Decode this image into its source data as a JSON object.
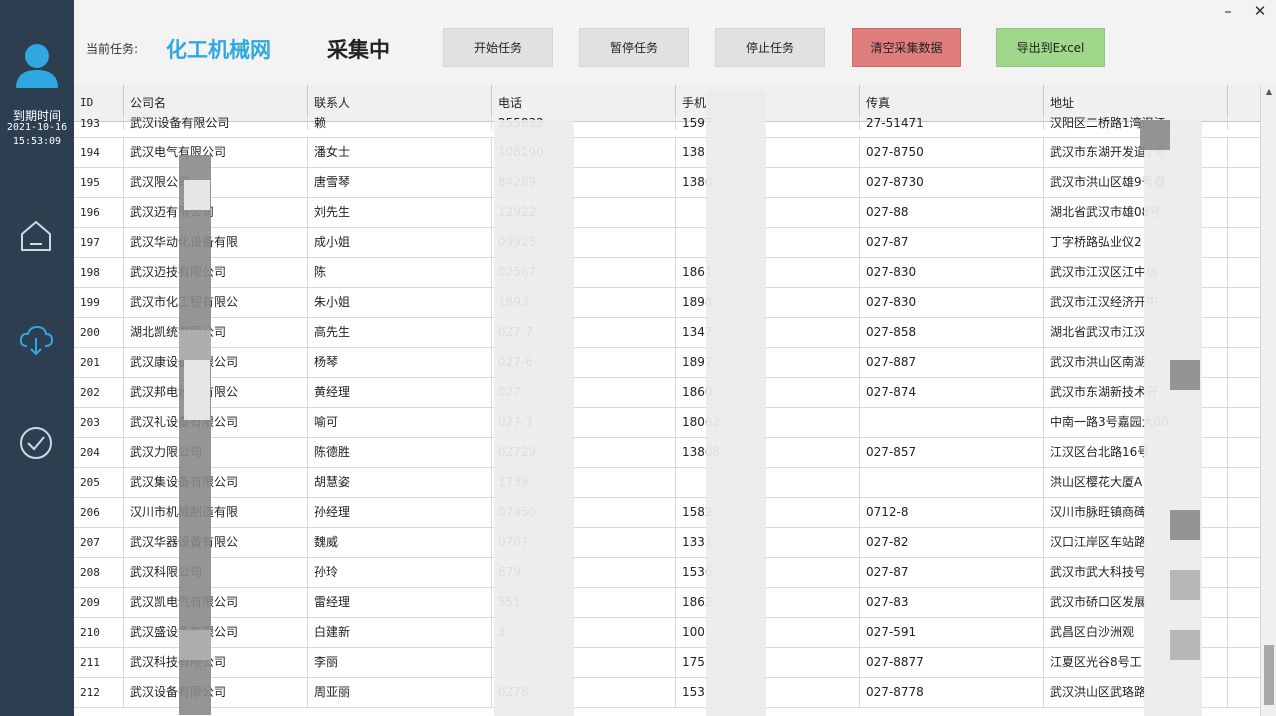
{
  "sidebar": {
    "expire_label": "到期时间",
    "expire_date": "2021-10-16",
    "expire_time": "15:53:09",
    "icons": [
      "user-icon",
      "home-icon",
      "cloud-download-icon",
      "check-circle-icon"
    ]
  },
  "window": {
    "minimize": "–",
    "close": "✕"
  },
  "toolbar": {
    "task_label": "当前任务:",
    "task_name": "化工机械网",
    "status": "采集中",
    "start_label": "开始任务",
    "pause_label": "暂停任务",
    "stop_label": "停止任务",
    "clear_label": "清空采集数据",
    "export_label": "导出到Excel"
  },
  "colors": {
    "sidebar": "#2d3e50",
    "task_name": "#2fa8e0",
    "clear_button": "#e07e7e",
    "export_button": "#9fd88a"
  },
  "table": {
    "columns": [
      "ID",
      "公司名",
      "联系人",
      "电话",
      "手机",
      "传真",
      "地址"
    ],
    "rows": [
      {
        "id": "193",
        "company": "武汉i设备有限公司",
        "contact": "赖",
        "phone": "255832",
        "mobile": "1597",
        "fax": "27-51471",
        "address": "汉阳区二桥路1湾汉江"
      },
      {
        "id": "194",
        "company": "武汉电气有限公司",
        "contact": "潘女士",
        "phone": "108190",
        "mobile": "138",
        "fax": "027-8750",
        "address": "武汉市东湖开发道2号"
      },
      {
        "id": "195",
        "company": "武汉限公司",
        "contact": "唐雪琴",
        "phone": "84289",
        "mobile": "1380",
        "fax": "027-8730",
        "address": "武汉市洪山区雄9号春"
      },
      {
        "id": "196",
        "company": "武汉迈有限公司",
        "contact": "刘先生",
        "phone": "12922",
        "mobile": "",
        "fax": "027-88",
        "address": "湖北省武汉市雄08号"
      },
      {
        "id": "197",
        "company": "武汉华动化设备有限",
        "contact": "成小姐",
        "phone": "09925",
        "mobile": "",
        "fax": "027-87",
        "address": "丁字桥路弘业仪2"
      },
      {
        "id": "198",
        "company": "武汉迈技有限公司",
        "contact": "陈",
        "phone": "02567",
        "mobile": "1861",
        "fax": "027-830",
        "address": "武汉市江汉区江中信"
      },
      {
        "id": "199",
        "company": "武汉市化工程有限公",
        "contact": "朱小姐",
        "phone": "1893",
        "mobile": "1898",
        "fax": "027-830",
        "address": "武汉市江汉经济开中"
      },
      {
        "id": "200",
        "company": "湖北凯统有限公司",
        "contact": "高先生",
        "phone": "027-7",
        "mobile": "1347",
        "fax": "027-858",
        "address": "湖北省武汉市江汉"
      },
      {
        "id": "201",
        "company": "武汉康设备有限公司",
        "contact": "杨琴",
        "phone": "027-6",
        "mobile": "1897",
        "fax": "027-887",
        "address": "武汉市洪山区南湖"
      },
      {
        "id": "202",
        "company": "武汉邦电设备有限公",
        "contact": "黄经理",
        "phone": "027",
        "mobile": "1860",
        "fax": "027-874",
        "address": "武汉市东湖新技术开"
      },
      {
        "id": "203",
        "company": "武汉礼设备有限公司",
        "contact": "喻可",
        "phone": "027-3",
        "mobile": "18062",
        "fax": "",
        "address": "中南一路3号嘉园大00"
      },
      {
        "id": "204",
        "company": "武汉力限公司",
        "contact": "陈德胜",
        "phone": "02729",
        "mobile": "13808",
        "fax": "027-857",
        "address": "江汉区台北路16号"
      },
      {
        "id": "205",
        "company": "武汉集设备有限公司",
        "contact": "胡慧姿",
        "phone": "1739",
        "mobile": "",
        "fax": "",
        "address": "洪山区樱花大厦A"
      },
      {
        "id": "206",
        "company": "汉川市机械制造有限",
        "contact": "孙经理",
        "phone": "07450",
        "mobile": "1582",
        "fax": "0712-8",
        "address": "汉川市脉旺镇商碑"
      },
      {
        "id": "207",
        "company": "武汉华器设备有限公",
        "contact": "魏威",
        "phone": "0707",
        "mobile": "1331",
        "fax": "027-82",
        "address": "汉口江岸区车站路"
      },
      {
        "id": "208",
        "company": "武汉科限公司",
        "contact": "孙玲",
        "phone": "679",
        "mobile": "1536",
        "fax": "027-87",
        "address": "武汉市武大科技号"
      },
      {
        "id": "209",
        "company": "武汉凯电气有限公司",
        "contact": "雷经理",
        "phone": "551",
        "mobile": "1862",
        "fax": "027-83",
        "address": "武汉市硚口区发展"
      },
      {
        "id": "210",
        "company": "武汉盛设备有限公司",
        "contact": "白建新",
        "phone": "3",
        "mobile": "100",
        "fax": "027-591",
        "address": "武昌区白沙洲观"
      },
      {
        "id": "211",
        "company": "武汉科技有限公司",
        "contact": "李丽",
        "phone": "",
        "mobile": "175",
        "fax": "027-8877",
        "address": "江夏区光谷8号工"
      },
      {
        "id": "212",
        "company": "武汉设备有限公司",
        "contact": "周亚丽",
        "phone": "0278",
        "mobile": "153",
        "fax": "027-8778",
        "address": "武汉洪山区武珞路"
      }
    ]
  }
}
